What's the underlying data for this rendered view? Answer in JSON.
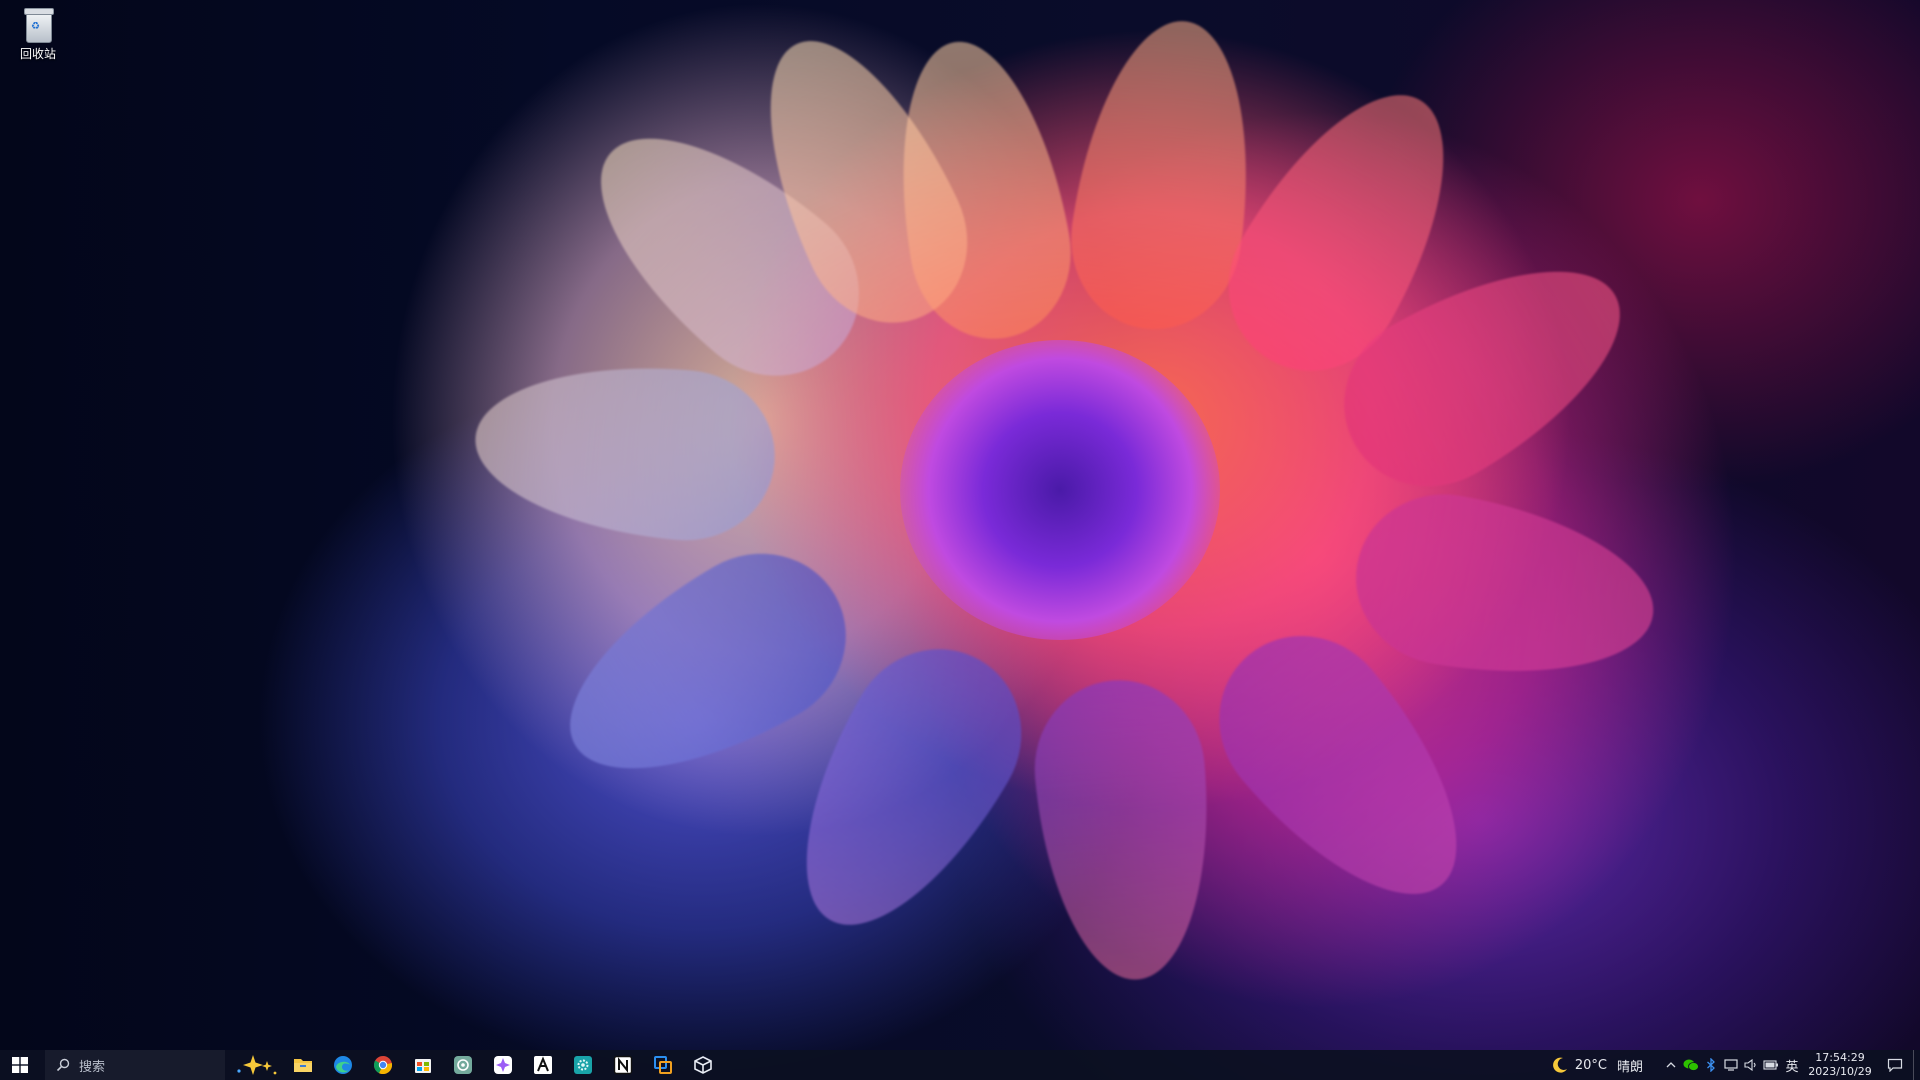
{
  "desktop": {
    "icons": [
      {
        "label": "回收站",
        "icon": "recycle-bin-icon"
      }
    ]
  },
  "taskbar": {
    "search_placeholder": "搜索",
    "pinned_apps": [
      {
        "name": "file-explorer-icon"
      },
      {
        "name": "edge-icon"
      },
      {
        "name": "chrome-icon"
      },
      {
        "name": "store-icon"
      },
      {
        "name": "chatgpt-icon"
      },
      {
        "name": "ai-app-icon"
      },
      {
        "name": "typora-icon"
      },
      {
        "name": "gear-app-icon"
      },
      {
        "name": "notion-icon"
      },
      {
        "name": "remote-desktop-icon"
      },
      {
        "name": "package-icon"
      }
    ],
    "weather": {
      "temperature": "20°C",
      "condition": "晴朗",
      "icon": "moon-icon"
    },
    "tray_icons": [
      "chevron-up-icon",
      "wechat-icon",
      "bluetooth-icon",
      "network-icon",
      "volume-icon",
      "battery-icon"
    ],
    "ime": "英",
    "clock": {
      "time": "17:54:29",
      "date": "2023/10/29"
    }
  },
  "colors": {
    "taskbar_bg": "#0c1022",
    "accent": "#0a64d8"
  }
}
